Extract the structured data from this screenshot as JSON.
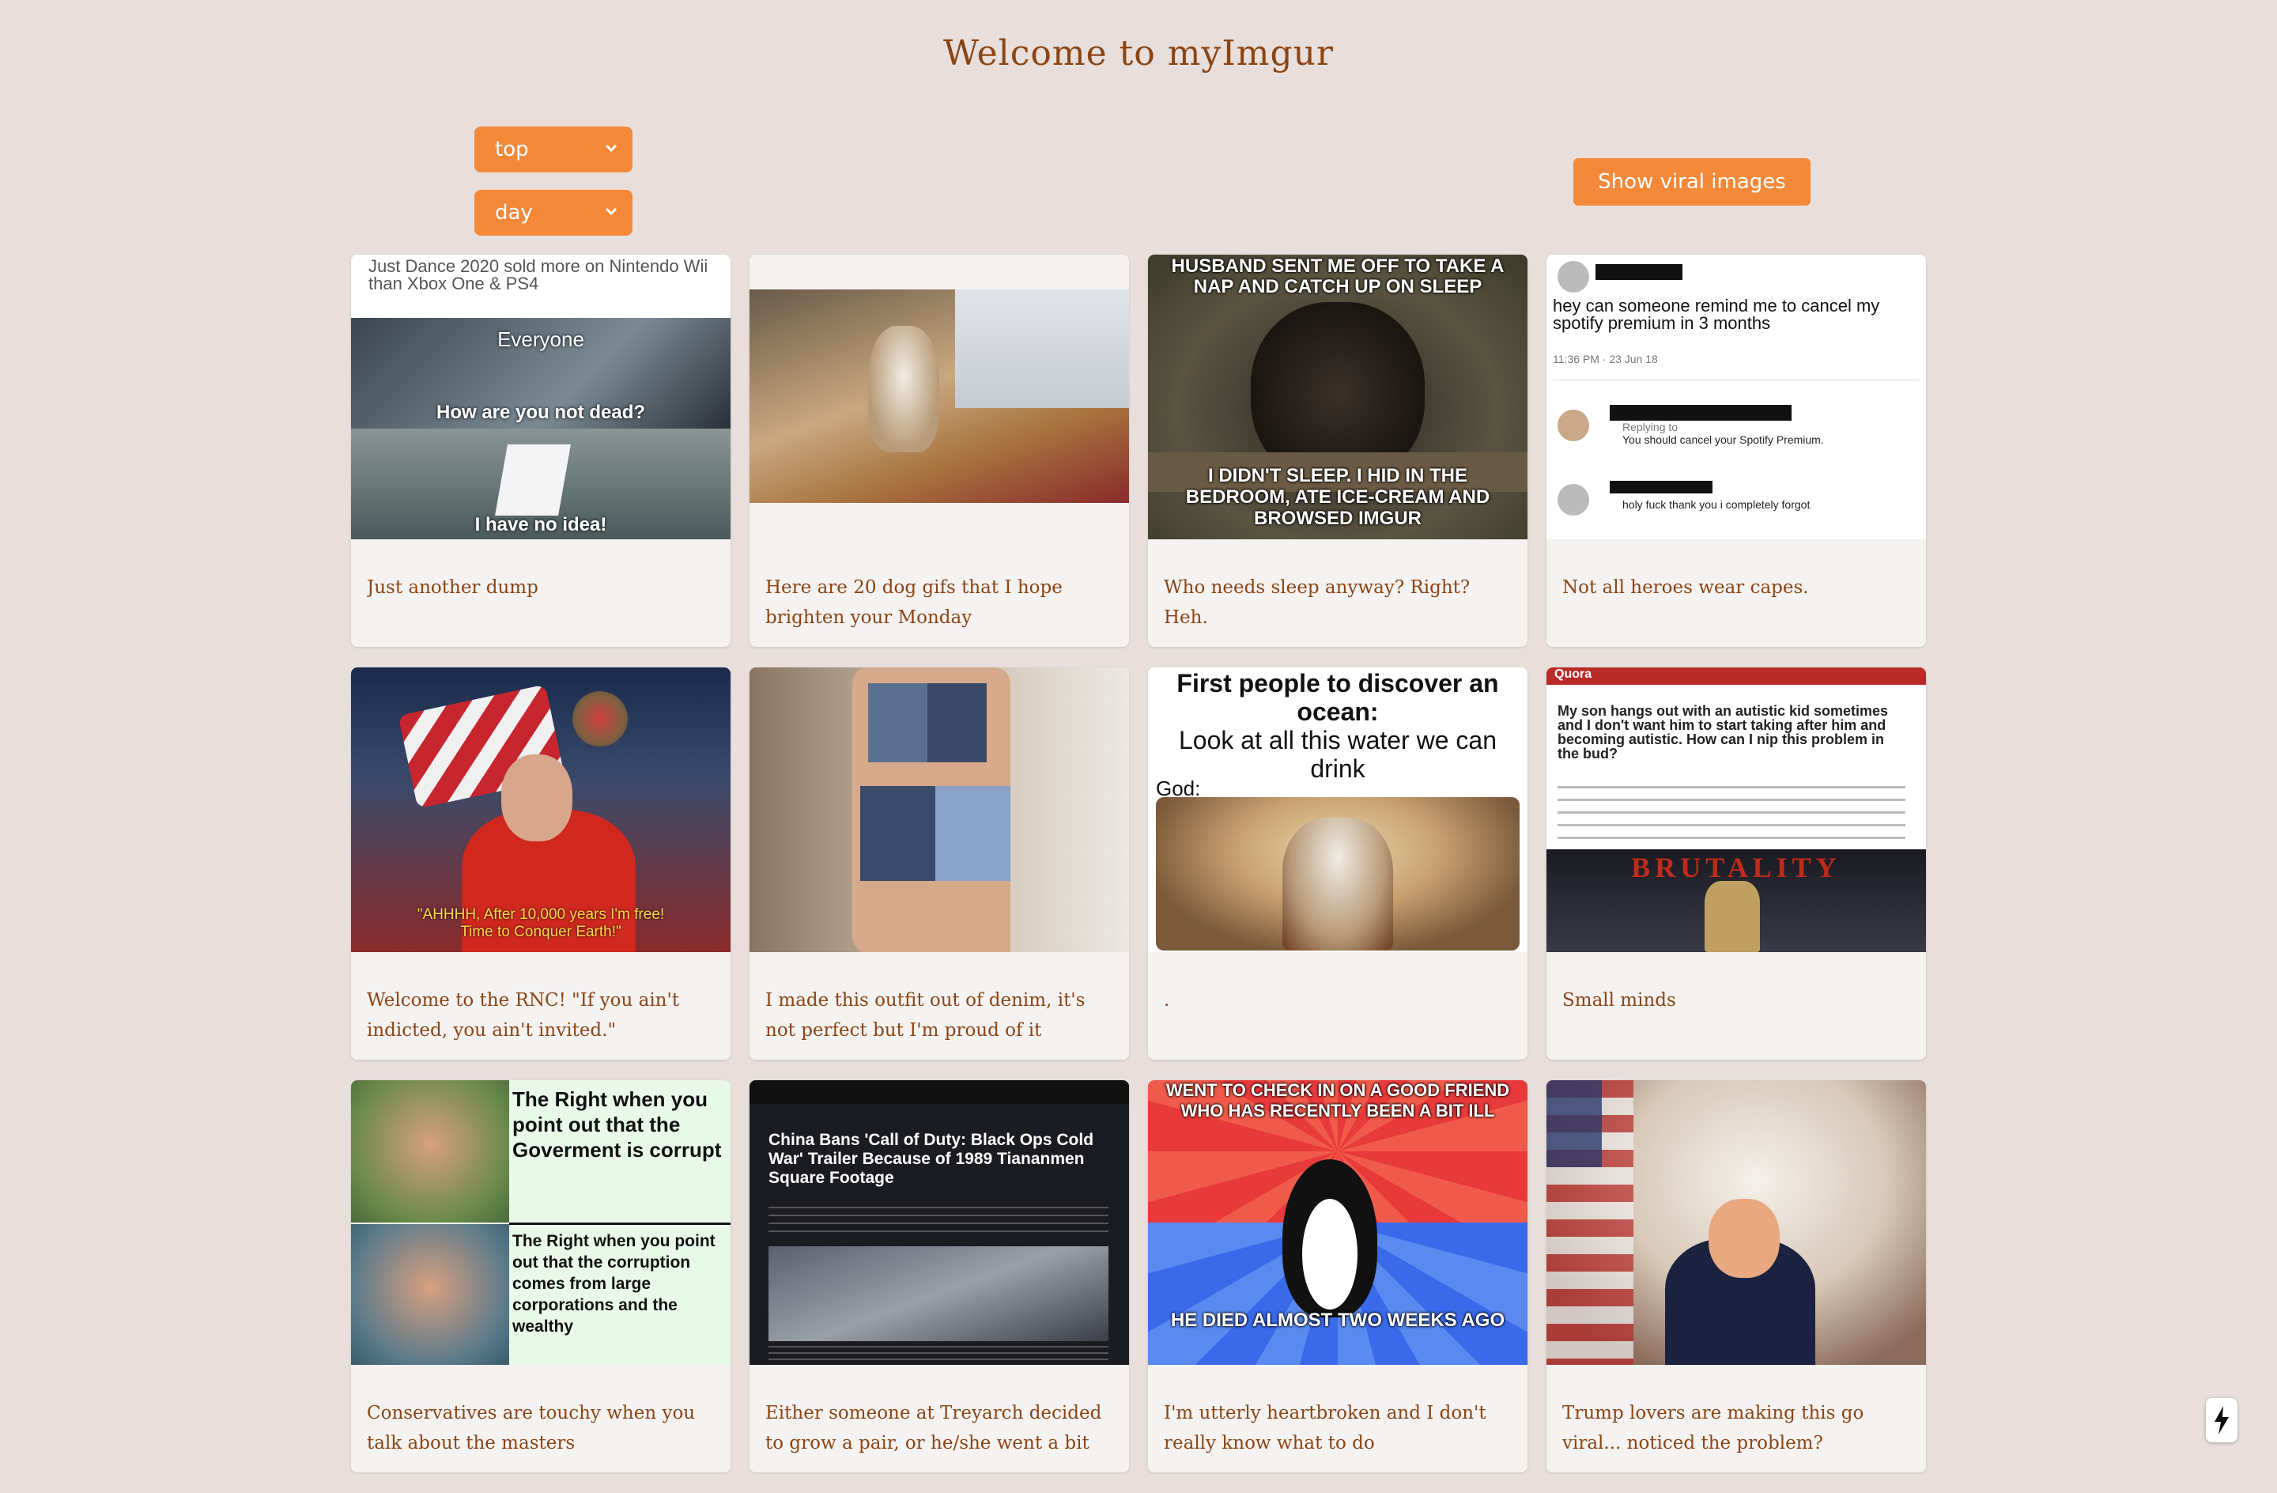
{
  "page": {
    "title": "Welcome to myImgur"
  },
  "controls": {
    "section_select": {
      "value": "top"
    },
    "window_select": {
      "value": "day"
    },
    "viral_button_label": "Show viral images"
  },
  "posts": [
    {
      "caption": "Just another dump",
      "image_text": [
        "Just Dance 2020 sold more on Nintendo Wii than Xbox One & PS4",
        "Everyone",
        "How are you not dead?",
        "I have no idea!"
      ]
    },
    {
      "caption": "Here are 20 dog gifs that I hope brighten your Monday",
      "image_text": []
    },
    {
      "caption": "Who needs sleep anyway? Right? Heh.",
      "image_text": [
        "HUSBAND SENT ME OFF TO TAKE A NAP AND CATCH UP ON SLEEP",
        "I DIDN'T SLEEP. I HID IN THE BEDROOM, ATE ICE-CREAM AND BROWSED IMGUR"
      ]
    },
    {
      "caption": "Not all heroes wear capes.",
      "image_text": [
        "hey can someone remind me to cancel my spotify premium in 3 months",
        "11:36 PM · 23 Jun 18",
        "Replying to",
        "You should cancel your Spotify Premium.",
        "holy fuck thank you i completely forgot"
      ]
    },
    {
      "caption": "Welcome to the RNC! \"If you ain't indicted, you ain't invited.\"",
      "image_text": [
        "\"AHHHH, After 10,000 years I'm free! Time to Conquer Earth!\""
      ]
    },
    {
      "caption": "I made this outfit out of denim, it's not perfect but I'm proud of it",
      "image_text": []
    },
    {
      "caption": ".",
      "image_text": [
        "First people to discover an ocean:",
        "Look at all this water we can drink",
        "God:"
      ]
    },
    {
      "caption": "Small minds",
      "image_text": [
        "Quora",
        "My son hangs out with an autistic kid sometimes and I don't want him to start taking after him and becoming autistic. How can I nip this problem in the bud?",
        "BRUTALITY"
      ]
    },
    {
      "caption": "Conservatives are touchy when you talk about the masters",
      "image_text": [
        "The Right when you point out that the Goverment is corrupt",
        "The Right when you point out that the corruption comes from large corporations and the wealthy"
      ]
    },
    {
      "caption": "Either someone at Treyarch decided to grow a pair, or he/she went a bit nuts ...",
      "image_text": [
        "China Bans 'Call of Duty: Black Ops Cold War' Trailer Because of 1989 Tiananmen Square Footage"
      ]
    },
    {
      "caption": "I'm utterly heartbroken and I don't really know what to do",
      "image_text": [
        "WENT TO CHECK IN ON A GOOD FRIEND WHO HAS RECENTLY BEEN A BIT ILL",
        "HE DIED ALMOST TWO WEEKS AGO"
      ]
    },
    {
      "caption": "Trump lovers are making this go viral... noticed the problem?",
      "image_text": []
    }
  ],
  "colors": {
    "accent": "#f5893a",
    "text": "#8b4513",
    "background": "#e8dfdc",
    "card": "#f5f2f2"
  },
  "icons": {
    "dev_indicator": "lightning-bolt-icon"
  }
}
